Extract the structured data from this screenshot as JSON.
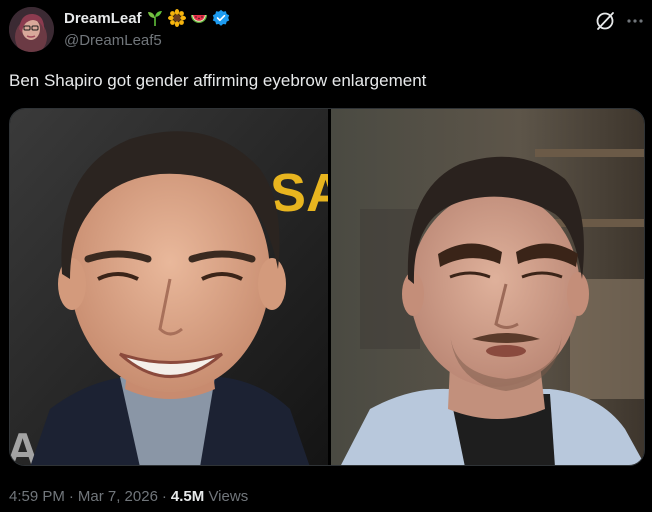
{
  "user": {
    "display_name": "DreamLeaf",
    "handle": "@DreamLeaf5",
    "emoji_icons": [
      "seedling-icon",
      "sunflower-icon",
      "watermelon-icon"
    ],
    "verified_badge": "verified-badge-icon"
  },
  "post": {
    "text": "Ben Shapiro got gender affirming eyebrow enlargement"
  },
  "meta": {
    "time": "4:59 PM",
    "separator": "·",
    "date": "Mar 7, 2026",
    "views_count": "4.5M",
    "views_label": "Views"
  },
  "icons": {
    "grok": "grok-icon",
    "more": "more-options-icon"
  },
  "media": {
    "backdrop_text": "SAR",
    "backdrop_text_bottom": "AP"
  },
  "colors": {
    "background": "#000000",
    "text_primary": "#e7e9ea",
    "text_secondary": "#71767b",
    "verified_blue": "#1d9bf0",
    "border": "#2f3336"
  }
}
